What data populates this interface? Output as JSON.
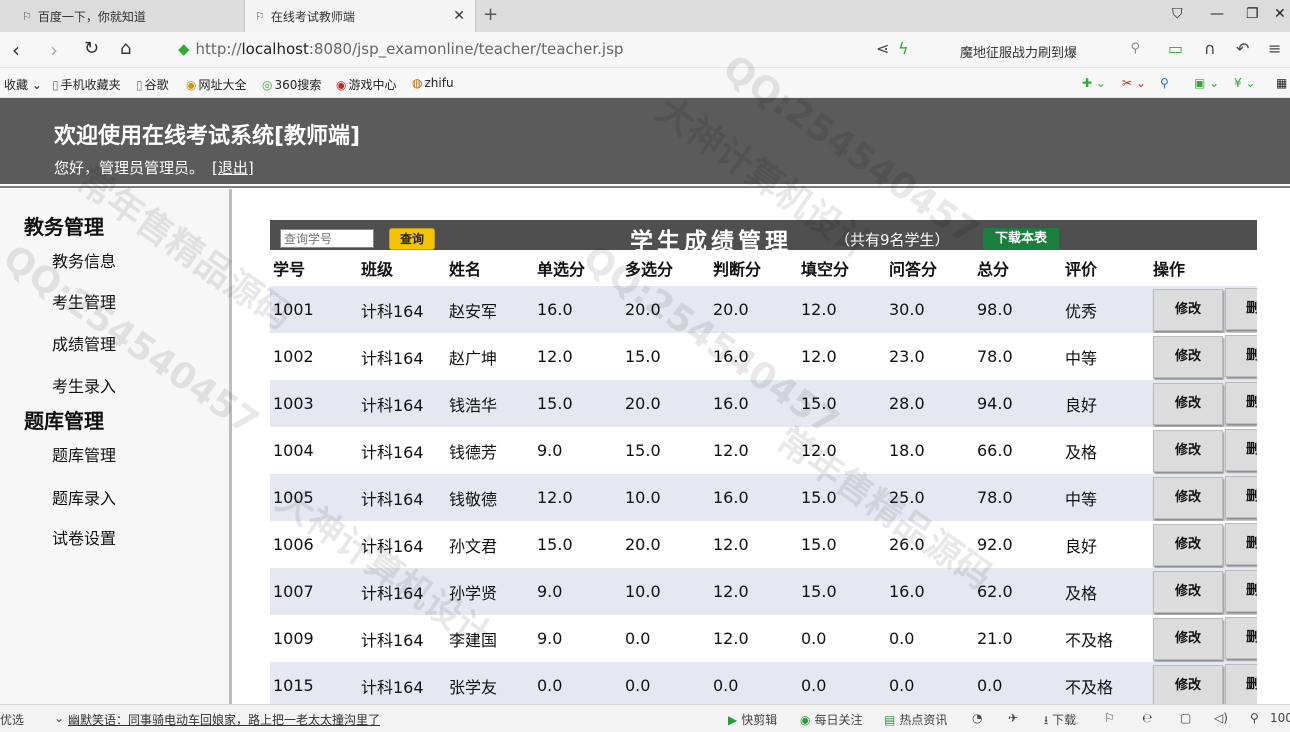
{
  "browser": {
    "tabs": [
      {
        "title": "百度一下，你就知道"
      },
      {
        "title": "在线考试教师端"
      }
    ],
    "url_prefix": "http://",
    "url_host": "localhost",
    "url_rest": ":8080/jsp_examonline/teacher/teacher.jsp",
    "search_text": "魔地征服战力刷到爆",
    "bookmarks": [
      "收藏",
      "手机收藏夹",
      "谷歌",
      "网址大全",
      "360搜索",
      "游戏中心",
      "zhifu"
    ]
  },
  "header": {
    "title": "欢迎使用在线考试系统[教师端]",
    "greeting": "您好，管理员管理员。",
    "logout": "[退出]"
  },
  "sidebar": {
    "sections": [
      {
        "title": "教务管理",
        "items": [
          "教务信息",
          "考生管理",
          "成绩管理",
          "考生录入"
        ]
      },
      {
        "title": "题库管理",
        "items": [
          "题库管理",
          "题库录入",
          "试卷设置"
        ]
      }
    ]
  },
  "main": {
    "search_placeholder": "查询学号",
    "search_button": "查询",
    "title": "学生成绩管理",
    "count_text": "（共有9名学生）",
    "download_button": "下载本表",
    "edit_label": "修改",
    "delete_label": "删",
    "columns": [
      "学号",
      "班级",
      "姓名",
      "单选分",
      "多选分",
      "判断分",
      "填空分",
      "问答分",
      "总分",
      "评价",
      "操作"
    ],
    "rows": [
      [
        "1001",
        "计科164",
        "赵安军",
        "16.0",
        "20.0",
        "20.0",
        "12.0",
        "30.0",
        "98.0",
        "优秀"
      ],
      [
        "1002",
        "计科164",
        "赵广坤",
        "12.0",
        "15.0",
        "16.0",
        "12.0",
        "23.0",
        "78.0",
        "中等"
      ],
      [
        "1003",
        "计科164",
        "钱浩华",
        "15.0",
        "20.0",
        "16.0",
        "15.0",
        "28.0",
        "94.0",
        "良好"
      ],
      [
        "1004",
        "计科164",
        "钱德芳",
        "9.0",
        "15.0",
        "12.0",
        "12.0",
        "18.0",
        "66.0",
        "及格"
      ],
      [
        "1005",
        "计科164",
        "钱敬德",
        "12.0",
        "10.0",
        "16.0",
        "15.0",
        "25.0",
        "78.0",
        "中等"
      ],
      [
        "1006",
        "计科164",
        "孙文君",
        "15.0",
        "20.0",
        "12.0",
        "15.0",
        "26.0",
        "92.0",
        "良好"
      ],
      [
        "1007",
        "计科164",
        "孙学贤",
        "9.0",
        "10.0",
        "12.0",
        "15.0",
        "16.0",
        "62.0",
        "及格"
      ],
      [
        "1009",
        "计科164",
        "李建国",
        "9.0",
        "0.0",
        "12.0",
        "0.0",
        "0.0",
        "21.0",
        "不及格"
      ],
      [
        "1015",
        "计科164",
        "张学友",
        "0.0",
        "0.0",
        "0.0",
        "0.0",
        "0.0",
        "0.0",
        "不及格"
      ]
    ]
  },
  "statusbar": {
    "left": "优选",
    "news": "幽默笑语：同事骑电动车回娘家，路上把一老太太撞沟里了",
    "items": [
      "快剪辑",
      "每日关注",
      "热点资讯",
      "下载"
    ],
    "zoom": "100"
  },
  "watermark": [
    "QQ:254540457",
    "大神计算机设计",
    "常年售精品源码"
  ],
  "colors": {
    "header_bg": "#5b5b5b",
    "toolbar_bg": "#4f4f4f",
    "query_button": "#f5c400",
    "download_button": "#1a7f3c",
    "row_stripe": "#e5e8f0"
  }
}
